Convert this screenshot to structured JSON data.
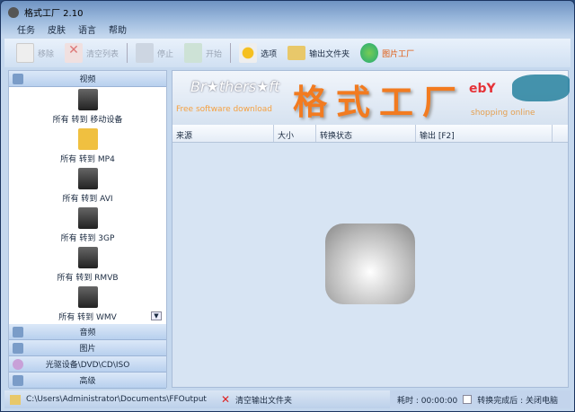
{
  "window": {
    "title": "格式工厂 2.10"
  },
  "menu": [
    "任务",
    "皮肤",
    "语言",
    "帮助"
  ],
  "toolbar": {
    "remove": "移除",
    "clear_list": "清空列表",
    "stop": "停止",
    "start": "开始",
    "options": "选项",
    "output_folder": "输出文件夹",
    "picture_factory": "图片工厂"
  },
  "sidebar": {
    "video": "视频",
    "items": [
      "所有 转到 移动设备",
      "所有 转到 MP4",
      "所有 转到 AVI",
      "所有 转到 3GP",
      "所有 转到 RMVB",
      "所有 转到 WMV"
    ],
    "audio": "音频",
    "picture": "图片",
    "rom": "光驱设备\\DVD\\CD\\ISO",
    "advanced": "高级"
  },
  "banner": {
    "brothersoft": "Br★thers★ft",
    "free": "Free software download",
    "title": "格式工厂",
    "ebay": "ebY",
    "shopping": "shopping online"
  },
  "table": {
    "columns": [
      "来源",
      "大小",
      "转换状态",
      "输出 [F2]"
    ]
  },
  "status": {
    "path": "C:\\Users\\Administrator\\Documents\\FFOutput",
    "clear_output": "清空输出文件夹",
    "time": "耗时 : 00:00:00",
    "after": "转换完成后 : 关闭电脑"
  }
}
